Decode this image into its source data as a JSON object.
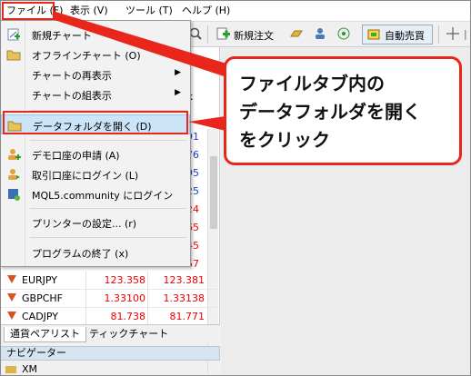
{
  "menubar": {
    "items": [
      "ファイル (F)",
      "表示 (V)",
      "ツール (T)",
      "ヘルプ (H)"
    ]
  },
  "toolbar": {
    "new_order": "新規注文",
    "auto_trade": "自動売買"
  },
  "market_watch": {
    "ask_header": "sk",
    "side_values": [
      "91",
      "76",
      "95",
      "25",
      "24",
      "65",
      "45",
      "57"
    ],
    "rows": [
      {
        "symbol": "EURJPY",
        "bid": "123.358",
        "ask": "123.381"
      },
      {
        "symbol": "GBPCHF",
        "bid": "1.33100",
        "ask": "1.33138"
      },
      {
        "symbol": "CADJPY",
        "bid": "81.738",
        "ask": "81.771"
      }
    ],
    "tabs": [
      "通貨ペアリスト",
      "ティックチャート"
    ]
  },
  "navigator": {
    "title": "ナビゲーター",
    "first_item": "XM"
  },
  "file_menu": {
    "items": [
      {
        "label": "新規チャート",
        "submenu": false
      },
      {
        "label": "オフラインチャート (O)",
        "submenu": false
      },
      {
        "label": "チャートの再表示",
        "submenu": true
      },
      {
        "label": "チャートの組表示",
        "submenu": true
      },
      {
        "label": "データフォルダを開く (D)",
        "submenu": false
      },
      {
        "label": "デモ口座の申請 (A)",
        "submenu": false
      },
      {
        "label": "取引口座にログイン (L)",
        "submenu": false
      },
      {
        "label": "MQL5.community にログイン",
        "submenu": false
      },
      {
        "label": "プリンターの設定... (r)",
        "submenu": false
      },
      {
        "label": "プログラムの終了 (x)",
        "submenu": false
      }
    ]
  },
  "callout": {
    "lines": [
      "ファイルタブ内の",
      "データフォルダを開く",
      "をクリック"
    ]
  },
  "colors": {
    "annotation_red": "#e8261c",
    "price_red": "#e00000",
    "highlight_blue": "#cce4f7"
  }
}
